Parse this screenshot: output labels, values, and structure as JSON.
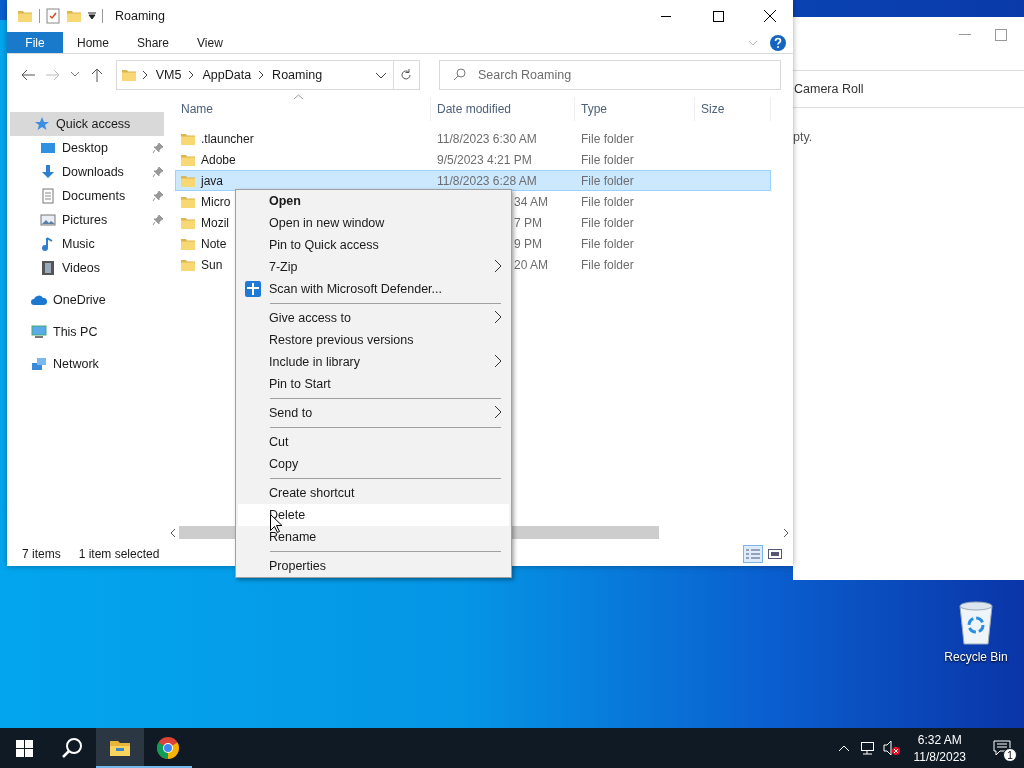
{
  "explorer": {
    "title": "Roaming",
    "ribbon_tabs": [
      {
        "label": "File",
        "kind": "file"
      },
      {
        "label": "Home",
        "kind": "tab"
      },
      {
        "label": "Share",
        "kind": "tab"
      },
      {
        "label": "View",
        "kind": "tab"
      }
    ],
    "address": {
      "path": [
        "VM5",
        "AppData",
        "Roaming"
      ]
    },
    "search": {
      "placeholder": "Search Roaming"
    },
    "nav": [
      {
        "label": "Quick access",
        "kind": "star",
        "selected": true,
        "children": [
          {
            "label": "Desktop",
            "kind": "desktop",
            "pinned": true,
            "selected": false
          },
          {
            "label": "Downloads",
            "kind": "downloads",
            "pinned": true,
            "selected": false
          },
          {
            "label": "Documents",
            "kind": "documents",
            "pinned": true,
            "selected": false
          },
          {
            "label": "Pictures",
            "kind": "pictures",
            "pinned": true,
            "selected": false
          },
          {
            "label": "Music",
            "kind": "music",
            "pinned": false,
            "selected": false
          },
          {
            "label": "Videos",
            "kind": "videos",
            "pinned": false,
            "selected": false
          }
        ]
      },
      {
        "label": "OneDrive",
        "kind": "cloud",
        "selected": false
      },
      {
        "label": "This PC",
        "kind": "pc",
        "selected": false
      },
      {
        "label": "Network",
        "kind": "network",
        "selected": false
      }
    ],
    "columns": [
      "Name",
      "Date modified",
      "Type",
      "Size"
    ],
    "rows": [
      {
        "name": ".tlauncher",
        "date": "11/8/2023 6:30 AM",
        "type": "File folder",
        "selected": false,
        "partial": false
      },
      {
        "name": "Adobe",
        "date": "9/5/2023 4:21 PM",
        "type": "File folder",
        "selected": false,
        "partial": false
      },
      {
        "name": "java",
        "date": "11/8/2023 6:28 AM",
        "type": "File folder",
        "selected": true,
        "partial": false
      },
      {
        "name": "Micro",
        "date": "34 AM",
        "type": "File folder",
        "selected": false,
        "partial": true
      },
      {
        "name": "Mozil",
        "date": "7 PM",
        "type": "File folder",
        "selected": false,
        "partial": true
      },
      {
        "name": "Note",
        "date": "9 PM",
        "type": "File folder",
        "selected": false,
        "partial": true
      },
      {
        "name": "Sun",
        "date": "20 AM",
        "type": "File folder",
        "selected": false,
        "partial": true
      }
    ],
    "status": {
      "count": "7 items",
      "selection": "1 item selected"
    }
  },
  "context_menu": {
    "items": [
      {
        "kind": "item",
        "label": "Open",
        "default": true,
        "submenu": false,
        "selected": false
      },
      {
        "kind": "item",
        "label": "Open in new window",
        "default": false,
        "submenu": false,
        "selected": false
      },
      {
        "kind": "item",
        "label": "Pin to Quick access",
        "default": false,
        "submenu": false,
        "selected": false
      },
      {
        "kind": "item",
        "label": "7-Zip",
        "default": false,
        "submenu": true,
        "selected": false
      },
      {
        "kind": "defender",
        "label": "Scan with Microsoft Defender...",
        "default": false,
        "submenu": false,
        "selected": false
      },
      {
        "kind": "separator"
      },
      {
        "kind": "item",
        "label": "Give access to",
        "default": false,
        "submenu": true,
        "selected": false
      },
      {
        "kind": "item",
        "label": "Restore previous versions",
        "default": false,
        "submenu": false,
        "selected": false
      },
      {
        "kind": "item",
        "label": "Include in library",
        "default": false,
        "submenu": true,
        "selected": false
      },
      {
        "kind": "item",
        "label": "Pin to Start",
        "default": false,
        "submenu": false,
        "selected": false
      },
      {
        "kind": "separator"
      },
      {
        "kind": "item",
        "label": "Send to",
        "default": false,
        "submenu": true,
        "selected": false
      },
      {
        "kind": "separator"
      },
      {
        "kind": "item",
        "label": "Cut",
        "default": false,
        "submenu": false,
        "selected": false
      },
      {
        "kind": "item",
        "label": "Copy",
        "default": false,
        "submenu": false,
        "selected": false
      },
      {
        "kind": "separator"
      },
      {
        "kind": "item",
        "label": "Create shortcut",
        "default": false,
        "submenu": false,
        "selected": false
      },
      {
        "kind": "item",
        "label": "Delete",
        "default": false,
        "submenu": false,
        "selected": true
      },
      {
        "kind": "item",
        "label": "Rename",
        "default": false,
        "submenu": false,
        "selected": false
      },
      {
        "kind": "separator"
      },
      {
        "kind": "item",
        "label": "Properties",
        "default": false,
        "submenu": false,
        "selected": false
      }
    ]
  },
  "background_window": {
    "breadcrumb": "Camera Roll",
    "message": "pty."
  },
  "desktop_icons": [
    {
      "label": "Recycle Bin"
    }
  ],
  "taskbar": {
    "apps": [
      {
        "kind": "explorer",
        "active": true
      },
      {
        "kind": "chrome",
        "active": false
      }
    ],
    "volume_muted": true,
    "time": "6:32 AM",
    "date": "11/8/2023",
    "notifications": "1"
  }
}
